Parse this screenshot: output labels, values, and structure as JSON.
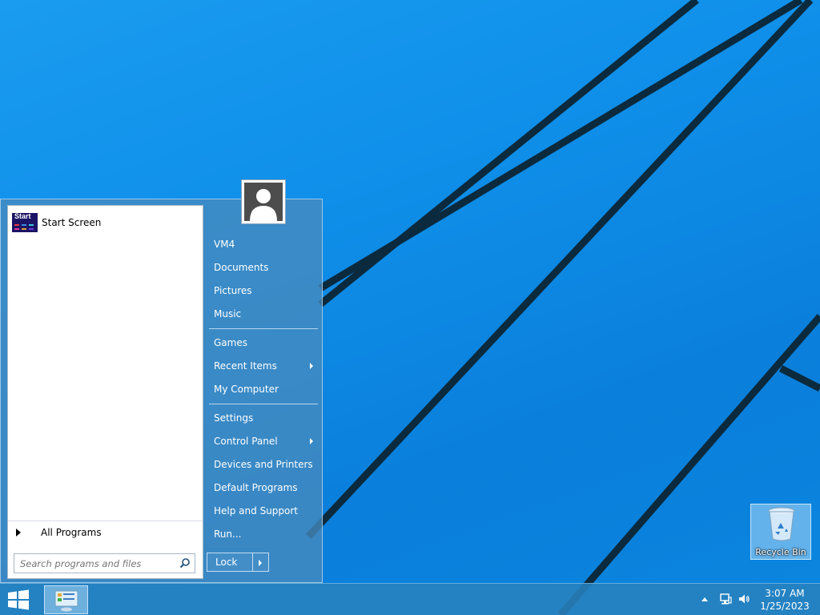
{
  "desktop": {
    "recycle_bin_label": "Recycle Bin"
  },
  "start_menu": {
    "pinned": [
      {
        "label": "Start Screen",
        "icon": "start-screen-icon",
        "icon_text": "Start"
      }
    ],
    "all_programs_label": "All Programs",
    "search_placeholder": "Search programs and files",
    "right_items": [
      {
        "label": "VM4",
        "submenu": false
      },
      {
        "label": "Documents",
        "submenu": false
      },
      {
        "label": "Pictures",
        "submenu": false
      },
      {
        "label": "Music",
        "submenu": false
      },
      {
        "label": "Games",
        "submenu": false
      },
      {
        "label": "Recent Items",
        "submenu": true
      },
      {
        "label": "My Computer",
        "submenu": false
      },
      {
        "label": "Settings",
        "submenu": false
      },
      {
        "label": "Control Panel",
        "submenu": true
      },
      {
        "label": "Devices and Printers",
        "submenu": false
      },
      {
        "label": "Default Programs",
        "submenu": false
      },
      {
        "label": "Help and Support",
        "submenu": false
      },
      {
        "label": "Run...",
        "submenu": false
      }
    ],
    "lock_label": "Lock"
  },
  "taskbar": {
    "clock_time": "3:07 AM",
    "clock_date": "1/25/2023"
  },
  "colors": {
    "desktop_blue": "#0f8fe9",
    "menu_glass": "#468abe",
    "taskbar": "#2882be"
  }
}
